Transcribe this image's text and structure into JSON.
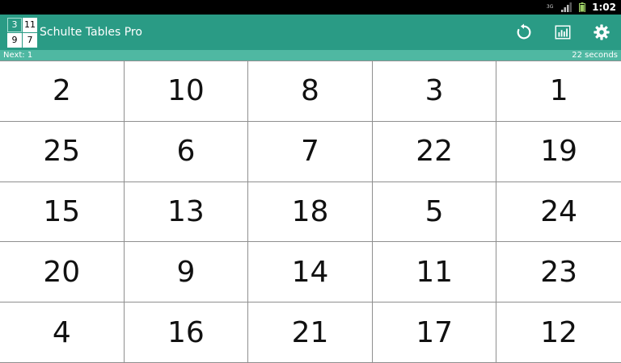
{
  "status_bar": {
    "network_label": "3G",
    "time": "1:02"
  },
  "app_bar": {
    "title": "Schulte Tables Pro",
    "logo_numbers": [
      "3",
      "11",
      "9",
      "7"
    ],
    "actions": [
      {
        "name": "restart",
        "icon": "refresh-icon"
      },
      {
        "name": "statistics",
        "icon": "bar-chart-icon"
      },
      {
        "name": "settings",
        "icon": "gear-icon"
      }
    ]
  },
  "info_bar": {
    "next_label": "Next: 1",
    "timer_label": "22 seconds"
  },
  "grid": {
    "cells": [
      "2",
      "10",
      "8",
      "3",
      "1",
      "25",
      "6",
      "7",
      "22",
      "19",
      "15",
      "13",
      "18",
      "5",
      "24",
      "20",
      "9",
      "14",
      "11",
      "23",
      "4",
      "16",
      "21",
      "17",
      "12"
    ]
  },
  "colors": {
    "primary": "#2a9b85",
    "info_bar": "#4fb8a2",
    "cell_border": "#8f8f8f"
  }
}
